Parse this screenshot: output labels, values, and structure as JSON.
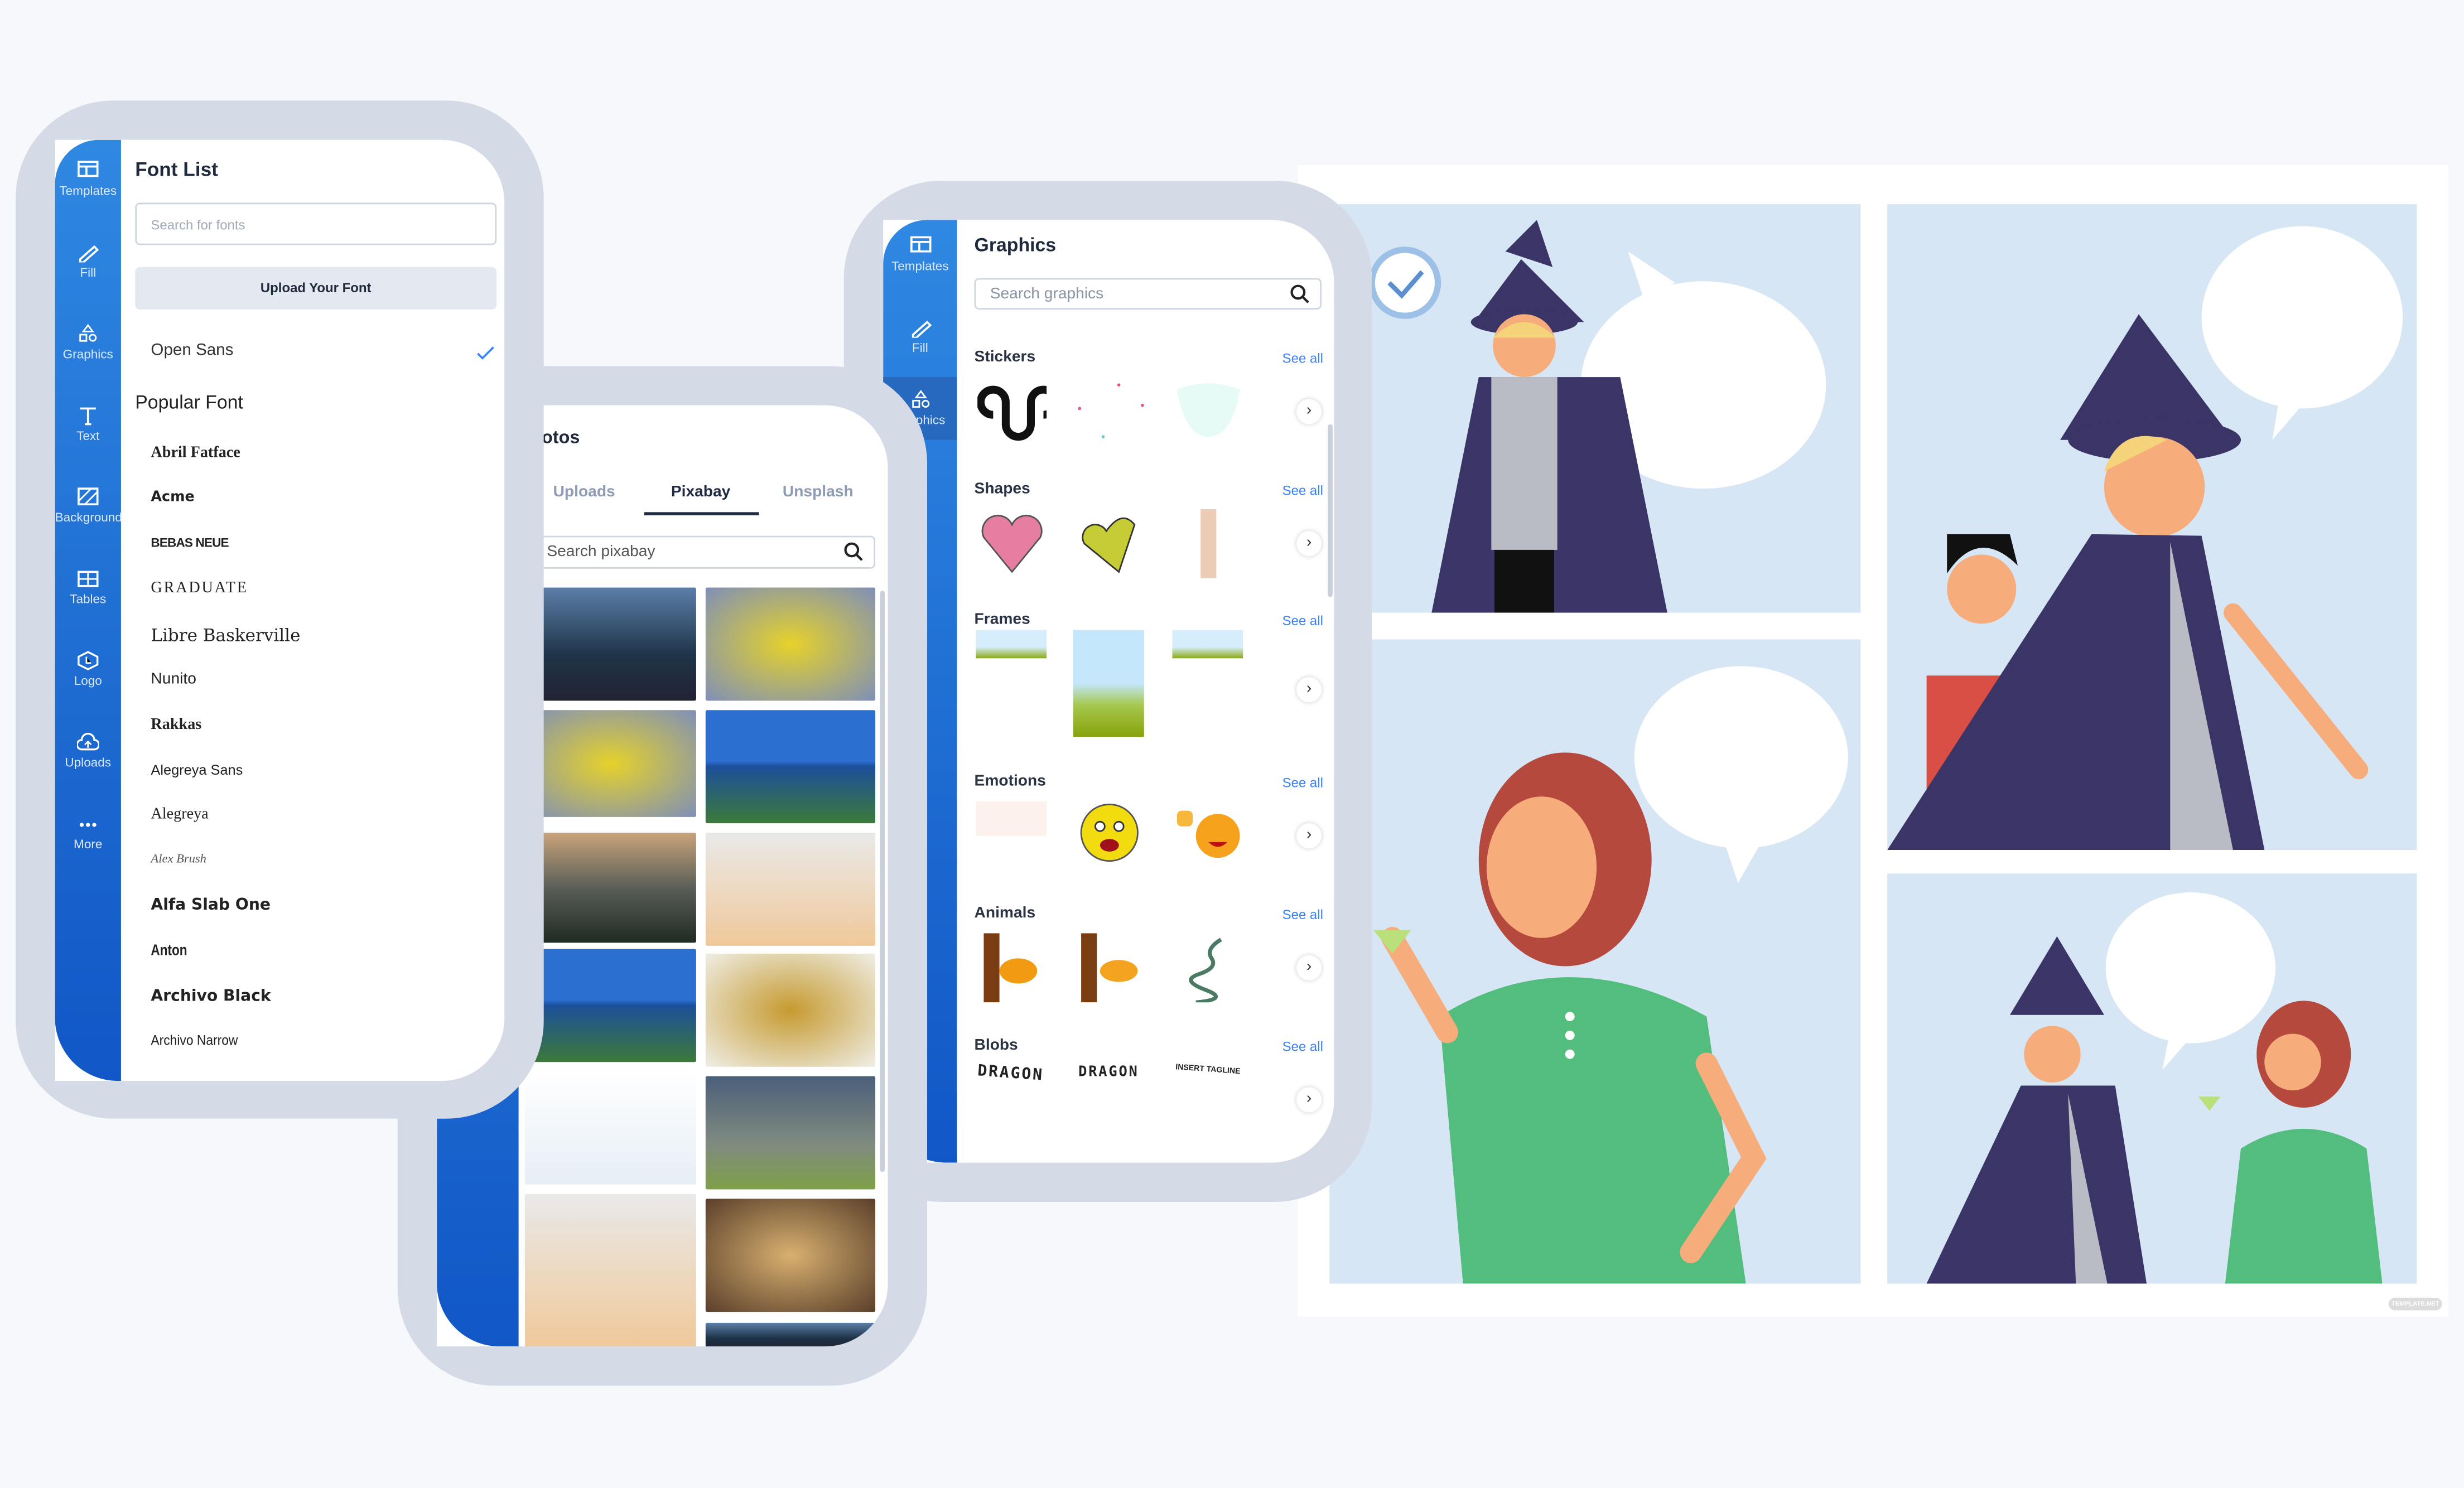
{
  "colors": {
    "sidebar_top": "#2f88e2",
    "sidebar_bottom": "#1157c6",
    "frame": "#d5dbe6",
    "accent": "#3b82f6",
    "comic_panel": "#d6e6f5"
  },
  "font_panel": {
    "sidebar": [
      {
        "label": "Templates",
        "icon": "templates-icon"
      },
      {
        "label": "Fill",
        "icon": "pencil-icon"
      },
      {
        "label": "Graphics",
        "icon": "shapes-icon"
      },
      {
        "label": "Text",
        "icon": "text-icon"
      },
      {
        "label": "Background",
        "icon": "background-icon"
      },
      {
        "label": "Tables",
        "icon": "table-icon"
      },
      {
        "label": "Logo",
        "icon": "logo-icon"
      },
      {
        "label": "Uploads",
        "icon": "cloud-upload-icon"
      },
      {
        "label": "More",
        "icon": "more-icon"
      }
    ],
    "title": "Font List",
    "search_placeholder": "Search for fonts",
    "upload_label": "Upload Your Font",
    "selected_font": "Open Sans",
    "popular_heading": "Popular Font",
    "fonts": [
      "Abril Fatface",
      "Acme",
      "BEBAS NEUE",
      "GRADUATE",
      "Libre Baskerville",
      "Nunito",
      "Rakkas",
      "Alegreya Sans",
      "Alegreya",
      "Alex Brush",
      "Alfa Slab One",
      "Anton",
      "Archivo Black",
      "Archivo Narrow"
    ]
  },
  "photos_panel": {
    "title": "Photos",
    "tabs": [
      {
        "label": "Uploads"
      },
      {
        "label": "Pixabay",
        "active": true
      },
      {
        "label": "Unsplash"
      }
    ],
    "search_placeholder": "Search pixabay"
  },
  "graphics_panel": {
    "sidebar": [
      {
        "label": "Templates"
      },
      {
        "label": "Fill"
      },
      {
        "label": "Graphics",
        "active": true
      }
    ],
    "title": "Graphics",
    "search_placeholder": "Search graphics",
    "see_all": "See all",
    "sections": [
      {
        "title": "Stickers"
      },
      {
        "title": "Shapes"
      },
      {
        "title": "Frames"
      },
      {
        "title": "Emotions"
      },
      {
        "title": "Animals"
      },
      {
        "title": "Blobs"
      }
    ],
    "blob_texts": [
      "DRAGON",
      "DRAGON",
      "INSERT TAGLINE"
    ]
  },
  "watermark": "TEMPLATE.NET"
}
